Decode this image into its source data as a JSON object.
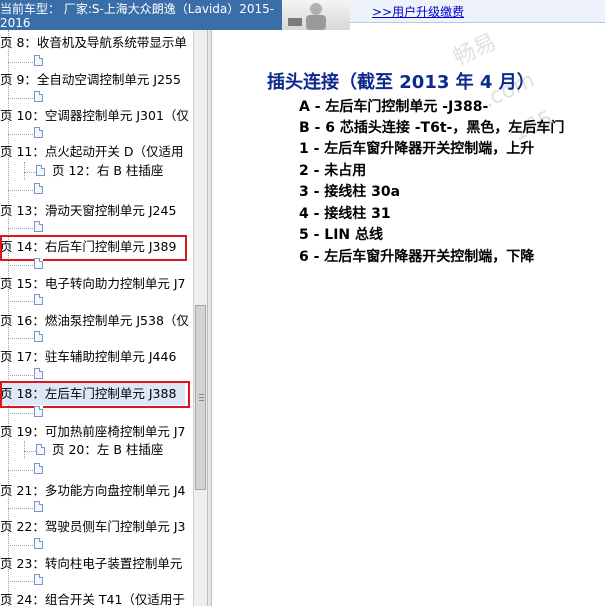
{
  "header": {
    "vehicle_line1": "当前车型：  厂家:S-上海大众朗逸（Lavida）2015-",
    "vehicle_line2": "2016",
    "upgrade_link": ">>用户升级缴费"
  },
  "tree": {
    "items": [
      {
        "label": "页 8：收音机及导航系统带显示单"
      },
      {
        "label": "页 9：全自动空调控制单元 J255"
      },
      {
        "label": "页 10：空调器控制单元 J301（仅"
      },
      {
        "label": "页 11：点火起动开关 D（仅适用"
      },
      {
        "label": "页 12：右 B 柱插座"
      },
      {
        "label": "页 13：滑动天窗控制单元 J245"
      },
      {
        "label": "页 14：右后车门控制单元 J389"
      },
      {
        "label": "页 15：电子转向助力控制单元 J7"
      },
      {
        "label": "页 16：燃油泵控制单元 J538（仅"
      },
      {
        "label": "页 17：驻车辅助控制单元 J446"
      },
      {
        "label": "页 18：左后车门控制单元 J388"
      },
      {
        "label": "页 19：可加热前座椅控制单元 J7"
      },
      {
        "label": "页 20：左 B 柱插座"
      },
      {
        "label": "页 21：多功能方向盘控制单元 J4"
      },
      {
        "label": "页 22：驾驶员侧车门控制单元 J3"
      },
      {
        "label": "页 23：转向柱电子装置控制单元"
      },
      {
        "label": "页 24：组合开关 T41（仅适用于"
      }
    ]
  },
  "content": {
    "heading": "插头连接（截至 2013 年 4 月）",
    "pins": [
      "A - 左后车门控制单元 -J388-",
      "B - 6 芯插头连接 -T6t-，黑色，左后车门",
      "1 - 左后车窗升降器开关控制端，上升",
      "2 - 未占用",
      "3 - 接线柱 30a",
      "4 - 接线柱 31",
      "5 - LIN 总线",
      "6 - 左后车窗升降器开关控制端，下降"
    ],
    "watermark": [
      "畅易",
      ".com",
      "165"
    ]
  },
  "colors": {
    "heading": "#0b2a8c",
    "highlight": "#e0151c",
    "header_bar": "#3a6ea8"
  }
}
